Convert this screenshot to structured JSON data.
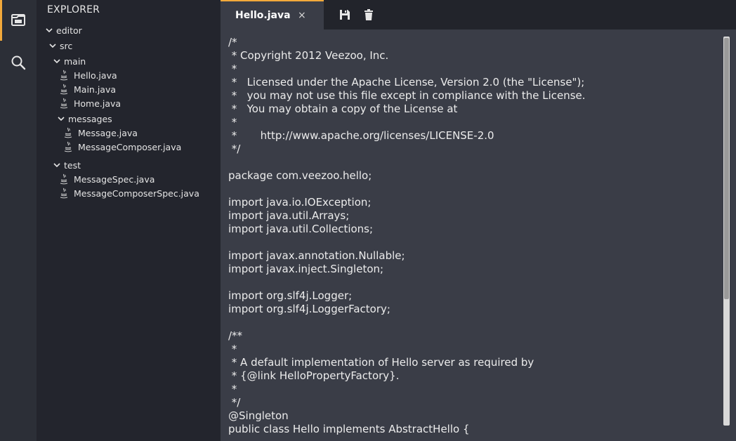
{
  "sidebar": {
    "title": "EXPLORER",
    "tree": [
      {
        "label": "editor",
        "type": "folder"
      },
      {
        "label": "src",
        "type": "folder"
      },
      {
        "label": "main",
        "type": "folder"
      },
      {
        "label": "Hello.java",
        "type": "file"
      },
      {
        "label": "Main.java",
        "type": "file"
      },
      {
        "label": "Home.java",
        "type": "file"
      },
      {
        "label": "messages",
        "type": "folder"
      },
      {
        "label": "Message.java",
        "type": "file"
      },
      {
        "label": "MessageComposer.java",
        "type": "file"
      },
      {
        "label": "test",
        "type": "folder"
      },
      {
        "label": "MessageSpec.java",
        "type": "file"
      },
      {
        "label": "MessageComposerSpec.java",
        "type": "file"
      }
    ]
  },
  "tabs": [
    {
      "label": "Hello.java",
      "close": "×"
    }
  ],
  "toolbar": {
    "save_icon": "save-icon",
    "delete_icon": "trash-icon"
  },
  "editor": {
    "lines": [
      "/*",
      " * Copyright 2012 Veezoo, Inc.",
      " *",
      " *   Licensed under the Apache License, Version 2.0 (the \"License\");",
      " *   you may not use this file except in compliance with the License.",
      " *   You may obtain a copy of the License at",
      " *",
      " *       http://www.apache.org/licenses/LICENSE-2.0",
      " */",
      "",
      "package com.veezoo.hello;",
      "",
      "import java.io.IOException;",
      "import java.util.Arrays;",
      "import java.util.Collections;",
      "",
      "import javax.annotation.Nullable;",
      "import javax.inject.Singleton;",
      "",
      "import org.slf4j.Logger;",
      "import org.slf4j.LoggerFactory;",
      "",
      "/**",
      " *",
      " * A default implementation of Hello server as required by",
      " * {@link HelloPropertyFactory}.",
      " *",
      " */",
      "@Singleton",
      "public class Hello implements AbstractHello {"
    ]
  },
  "colors": {
    "accent": "#f2a93b",
    "editor_bg": "#3a3d47",
    "sidebar_bg": "#23252d",
    "activity_bg": "#2c2f37"
  }
}
